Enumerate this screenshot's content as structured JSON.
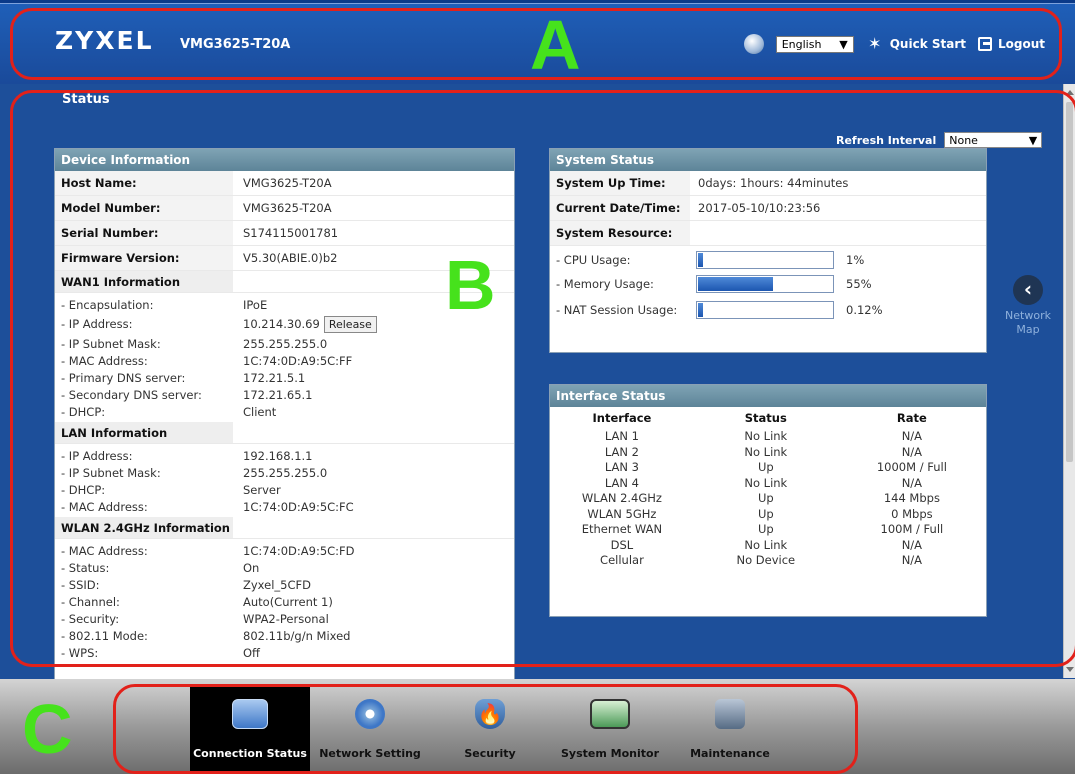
{
  "header": {
    "brand": "ZYXEL",
    "model": "VMG3625-T20A",
    "language": "English",
    "quick_start": "Quick Start",
    "logout": "Logout"
  },
  "callouts": {
    "a": "A",
    "b": "B",
    "c": "C"
  },
  "status": {
    "title": "Status",
    "refresh_label": "Refresh Interval",
    "refresh_value": "None"
  },
  "device_info": {
    "title": "Device Information",
    "host_name": {
      "label": "Host Name:",
      "value": "VMG3625-T20A"
    },
    "model_number": {
      "label": "Model Number:",
      "value": "VMG3625-T20A"
    },
    "serial_number": {
      "label": "Serial Number:",
      "value": "S174115001781"
    },
    "firmware_version": {
      "label": "Firmware Version:",
      "value": "V5.30(ABIE.0)b2"
    },
    "wan1": {
      "title": "WAN1 Information",
      "rows": [
        {
          "label": "- Encapsulation:",
          "value": "IPoE"
        },
        {
          "label": "- IP Address:",
          "value": "10.214.30.69"
        },
        {
          "label": "- IP Subnet Mask:",
          "value": "255.255.255.0"
        },
        {
          "label": "- MAC Address:",
          "value": "1C:74:0D:A9:5C:FF"
        },
        {
          "label": "- Primary DNS server:",
          "value": "172.21.5.1"
        },
        {
          "label": "- Secondary DNS server:",
          "value": "172.21.65.1"
        },
        {
          "label": "- DHCP:",
          "value": "Client"
        }
      ],
      "release_button": "Release"
    },
    "lan": {
      "title": "LAN Information",
      "rows": [
        {
          "label": "- IP Address:",
          "value": "192.168.1.1"
        },
        {
          "label": "- IP Subnet Mask:",
          "value": "255.255.255.0"
        },
        {
          "label": "- DHCP:",
          "value": "Server"
        },
        {
          "label": "- MAC Address:",
          "value": "1C:74:0D:A9:5C:FC"
        }
      ]
    },
    "wlan": {
      "title": "WLAN 2.4GHz Information",
      "rows": [
        {
          "label": "- MAC Address:",
          "value": "1C:74:0D:A9:5C:FD"
        },
        {
          "label": "- Status:",
          "value": "On"
        },
        {
          "label": "- SSID:",
          "value": "Zyxel_5CFD"
        },
        {
          "label": "- Channel:",
          "value": "Auto(Current 1)"
        },
        {
          "label": "- Security:",
          "value": "WPA2-Personal"
        },
        {
          "label": "- 802.11 Mode:",
          "value": "802.11b/g/n Mixed"
        },
        {
          "label": "- WPS:",
          "value": "Off"
        }
      ]
    }
  },
  "system_status": {
    "title": "System Status",
    "up_time": {
      "label": "System Up Time:",
      "value": "0days: 1hours: 44minutes"
    },
    "current_datetime": {
      "label": "Current Date/Time:",
      "value": "2017-05-10/10:23:56"
    },
    "resource_label": "System Resource:",
    "cpu": {
      "label": "- CPU Usage:",
      "value": "1%",
      "fraction": 0.04
    },
    "memory": {
      "label": "- Memory Usage:",
      "value": "55%",
      "fraction": 0.55
    },
    "nat": {
      "label": "- NAT Session Usage:",
      "value": "0.12%",
      "fraction": 0.04
    }
  },
  "interface_status": {
    "title": "Interface Status",
    "columns": [
      "Interface",
      "Status",
      "Rate"
    ],
    "rows": [
      [
        "LAN 1",
        "No Link",
        "N/A"
      ],
      [
        "LAN 2",
        "No Link",
        "N/A"
      ],
      [
        "LAN 3",
        "Up",
        "1000M / Full"
      ],
      [
        "LAN 4",
        "No Link",
        "N/A"
      ],
      [
        "WLAN 2.4GHz",
        "Up",
        "144 Mbps"
      ],
      [
        "WLAN 5GHz",
        "Up",
        "0 Mbps"
      ],
      [
        "Ethernet WAN",
        "Up",
        "100M / Full"
      ],
      [
        "DSL",
        "No Link",
        "N/A"
      ],
      [
        "Cellular",
        "No Device",
        "N/A"
      ]
    ]
  },
  "network_map": {
    "label_1": "Network",
    "label_2": "Map"
  },
  "bottom_nav": [
    {
      "label": "Connection Status",
      "active": true
    },
    {
      "label": "Network Setting",
      "active": false
    },
    {
      "label": "Security",
      "active": false
    },
    {
      "label": "System Monitor",
      "active": false
    },
    {
      "label": "Maintenance",
      "active": false
    }
  ]
}
